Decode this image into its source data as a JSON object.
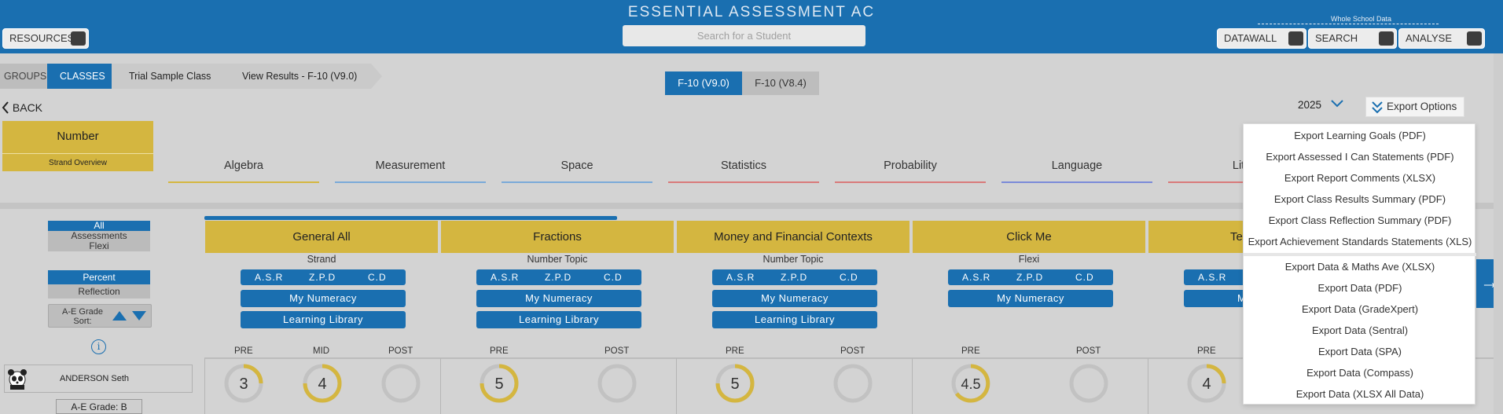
{
  "header": {
    "title": "ESSENTIAL ASSESSMENT AC",
    "search_placeholder": "Search for a Student",
    "resources_label": "RESOURCES",
    "whole_school_label": "Whole School Data",
    "datawall_label": "DATAWALL",
    "search_label": "SEARCH",
    "analyse_label": "ANALYSE"
  },
  "breadcrumb": {
    "groups": "GROUPS",
    "classes": "CLASSES",
    "class_name": "Trial Sample Class",
    "view": "View Results - F-10 (V9.0)"
  },
  "version_tabs": {
    "active": "F-10 (V9.0)",
    "inactive": "F-10 (V8.4)"
  },
  "back_label": "BACK",
  "number_card": {
    "title": "Number",
    "subtitle": "Strand Overview"
  },
  "strands": [
    {
      "label": "Algebra",
      "color": "#d4b640"
    },
    {
      "label": "Measurement",
      "color": "#7aaad8"
    },
    {
      "label": "Space",
      "color": "#7aaad8"
    },
    {
      "label": "Statistics",
      "color": "#d87a7a"
    },
    {
      "label": "Probability",
      "color": "#d87a7a"
    },
    {
      "label": "Language",
      "color": "#7a8ad8"
    },
    {
      "label": "Liter",
      "color": "#d87a7a"
    }
  ],
  "filters": {
    "all": "All",
    "assessments": "Assessments",
    "flexi": "Flexi",
    "percent": "Percent",
    "reflection": "Reflection",
    "sort_label_1": "A-E Grade",
    "sort_label_2": "Sort:"
  },
  "student": {
    "name": "ANDERSON Seth",
    "grade": "A-E Grade: B"
  },
  "columns": [
    {
      "title": "General All",
      "type": "Strand",
      "asr": [
        "A.S.R",
        "Z.P.D",
        "C.D"
      ],
      "buttons": [
        "My Numeracy",
        "Learning Library"
      ],
      "phases": [
        "PRE",
        "MID",
        "POST"
      ],
      "scores": [
        "3",
        "4",
        ""
      ]
    },
    {
      "title": "Fractions",
      "type": "Number Topic",
      "asr": [
        "A.S.R",
        "Z.P.D",
        "C.D"
      ],
      "buttons": [
        "My Numeracy",
        "Learning Library"
      ],
      "phases": [
        "PRE",
        "POST"
      ],
      "scores": [
        "5",
        ""
      ]
    },
    {
      "title": "Money and Financial Contexts",
      "type": "Number Topic",
      "asr": [
        "A.S.R",
        "Z.P.D",
        "C.D"
      ],
      "buttons": [
        "My Numeracy",
        "Learning Library"
      ],
      "phases": [
        "PRE",
        "POST"
      ],
      "scores": [
        "5",
        ""
      ]
    },
    {
      "title": "Click Me",
      "type": "Flexi",
      "asr": [
        "A.S.R",
        "Z.P.D",
        "C.D"
      ],
      "buttons": [
        "My Numeracy"
      ],
      "phases": [
        "PRE",
        "POST"
      ],
      "scores": [
        "4.5",
        ""
      ]
    },
    {
      "title": "Te",
      "type": "",
      "asr": [
        "A.S.R"
      ],
      "buttons": [
        "My"
      ],
      "phases": [
        "PRE"
      ],
      "scores": [
        "4"
      ]
    }
  ],
  "export": {
    "year": "2025",
    "button_label": "Export Options",
    "items_top": [
      "Export Learning Goals (PDF)",
      "Export Assessed I Can Statements (PDF)",
      "Export Report Comments (XLSX)",
      "Export Class Results Summary (PDF)",
      "Export Class Reflection Summary (PDF)",
      "Export Achievement Standards Statements (XLS)"
    ],
    "items_bottom": [
      "Export Data & Maths Ave (XLSX)",
      "Export Data (PDF)",
      "Export Data (GradeXpert)",
      "Export Data (Sentral)",
      "Export Data (SPA)",
      "Export Data (Compass)",
      "Export Data (XLSX All Data)"
    ]
  },
  "colors": {
    "primary": "#1a6fb0",
    "gold": "#d4b640",
    "background": "#d3d3d3"
  }
}
